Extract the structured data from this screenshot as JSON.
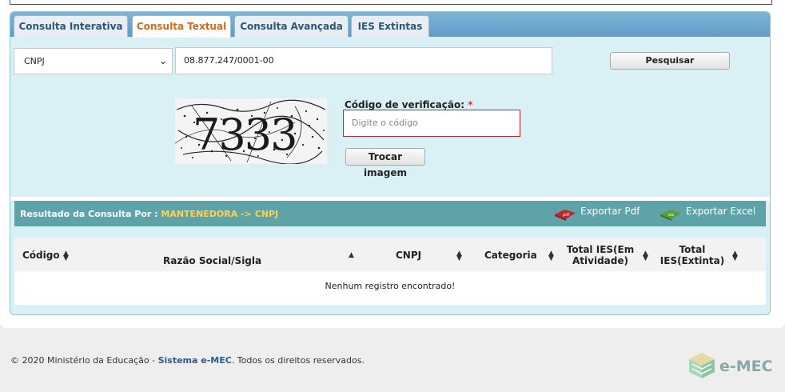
{
  "tabs": [
    {
      "label": "Consulta Interativa",
      "active": false
    },
    {
      "label": "Consulta Textual",
      "active": true
    },
    {
      "label": "Consulta Avançada",
      "active": false
    },
    {
      "label": "IES Extintas",
      "active": false
    }
  ],
  "search": {
    "type_value": "CNPJ",
    "query_value": "08.877.247/0001-00",
    "button_label": "Pesquisar"
  },
  "captcha": {
    "image_text": "7333",
    "label": "Código de verificação:",
    "required_mark": "*",
    "placeholder": "Digite o código",
    "swap_button_label": "Trocar imagem"
  },
  "results": {
    "title_prefix": "Resultado da Consulta Por :",
    "title_value": "MANTENEDORA -> CNPJ",
    "export_pdf_label": "Exportar Pdf",
    "export_excel_label": "Exportar Excel",
    "columns": [
      {
        "label": "Código"
      },
      {
        "label": "Razão Social/Sigla"
      },
      {
        "label": "CNPJ"
      },
      {
        "label": "Categoria"
      },
      {
        "label": "Total IES(Em Atividade)"
      },
      {
        "label": "Total IES(Extinta)"
      }
    ],
    "empty_message": "Nenhum registro encontrado!"
  },
  "footer": {
    "copyright_prefix": "© 2020 Ministério da Educação -",
    "link_text": "Sistema e-MEC",
    "copyright_suffix": ". Todos os direitos reservados.",
    "logo_text": "e-MEC"
  },
  "colors": {
    "active_tab": "#d2691e",
    "tab_text": "#2c5777",
    "panel_bg": "#d9f1f5",
    "results_bar": "#5fa3a9",
    "highlight": "#ffd24a",
    "required": "#d23a2a"
  }
}
